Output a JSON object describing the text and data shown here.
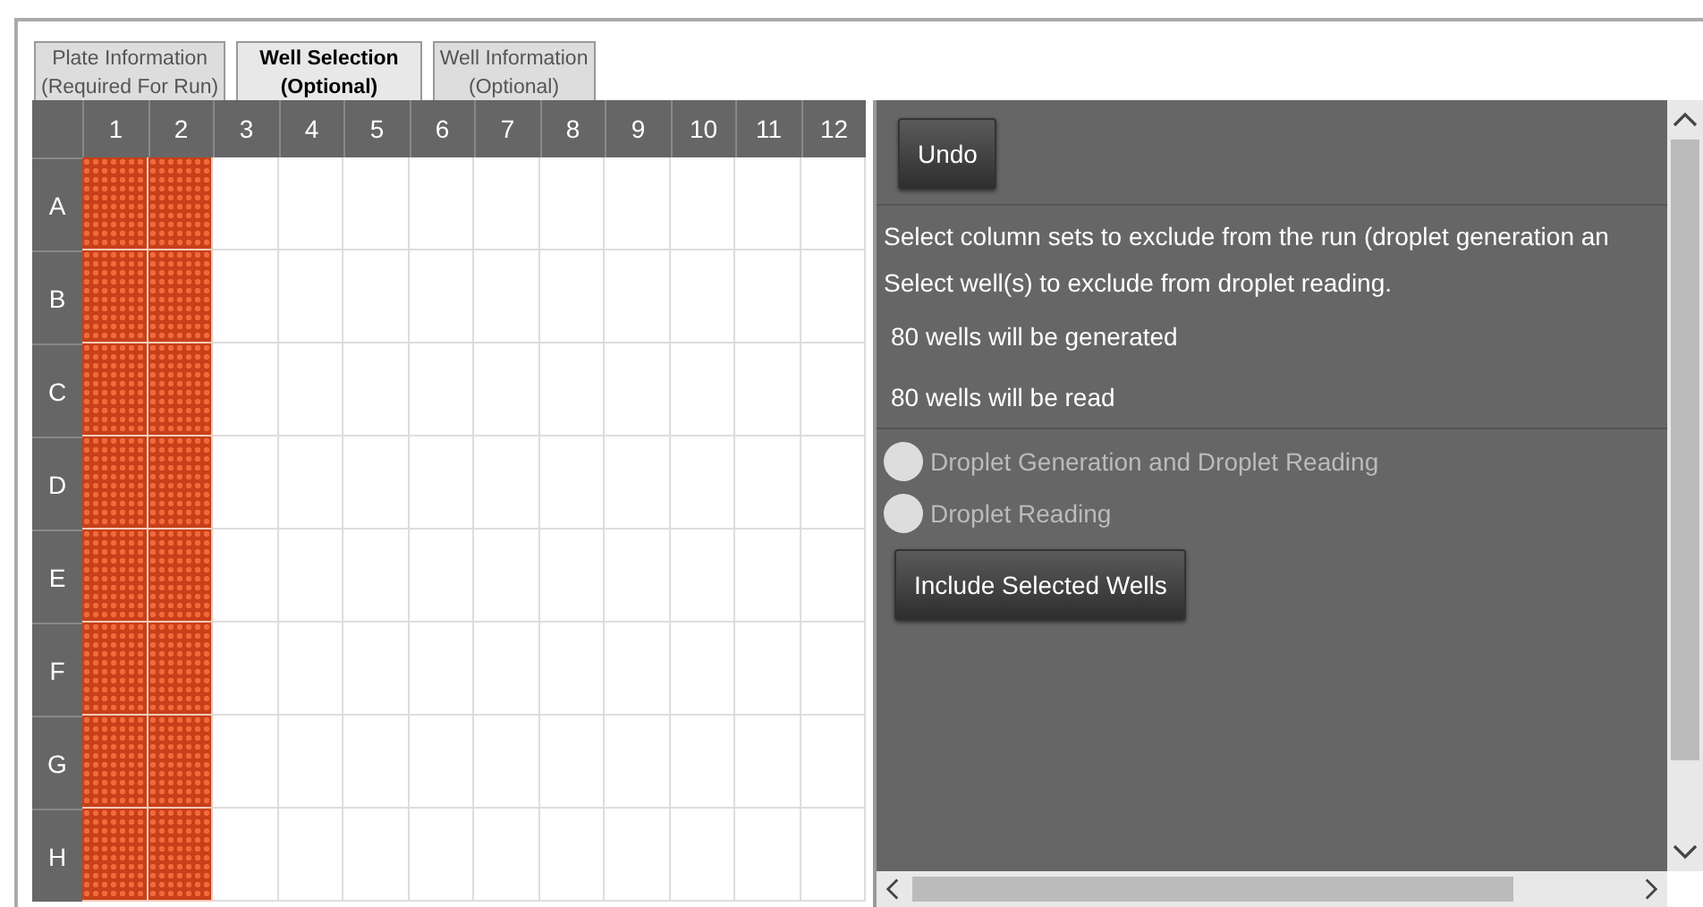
{
  "tabs": [
    {
      "label": "Plate Information",
      "sublabel": "(Required For Run)",
      "selected": false
    },
    {
      "label": "Well Selection",
      "sublabel": "(Optional)",
      "selected": true
    },
    {
      "label": "Well Information",
      "sublabel": "(Optional)",
      "selected": false
    }
  ],
  "plate": {
    "columns": [
      {
        "label": "1",
        "excluded": true
      },
      {
        "label": "2",
        "excluded": true
      },
      {
        "label": "3",
        "excluded": false
      },
      {
        "label": "4",
        "excluded": false
      },
      {
        "label": "5",
        "excluded": false
      },
      {
        "label": "6",
        "excluded": false
      },
      {
        "label": "7",
        "excluded": false
      },
      {
        "label": "8",
        "excluded": false
      },
      {
        "label": "9",
        "excluded": false
      },
      {
        "label": "10",
        "excluded": false
      },
      {
        "label": "11",
        "excluded": false
      },
      {
        "label": "12",
        "excluded": false
      }
    ],
    "rows": [
      "A",
      "B",
      "C",
      "D",
      "E",
      "F",
      "G",
      "H"
    ]
  },
  "panel": {
    "undo_button": "Undo",
    "instructions": [
      "Select column sets to exclude from the run (droplet generation an",
      "Select well(s) to exclude from droplet reading."
    ],
    "counts": [
      "80 wells will be generated",
      "80 wells will be read"
    ],
    "options": [
      {
        "label": "Droplet Generation and Droplet Reading",
        "selected": false
      },
      {
        "label": "Droplet Reading",
        "selected": false
      }
    ],
    "include_button": "Include Selected Wells"
  }
}
